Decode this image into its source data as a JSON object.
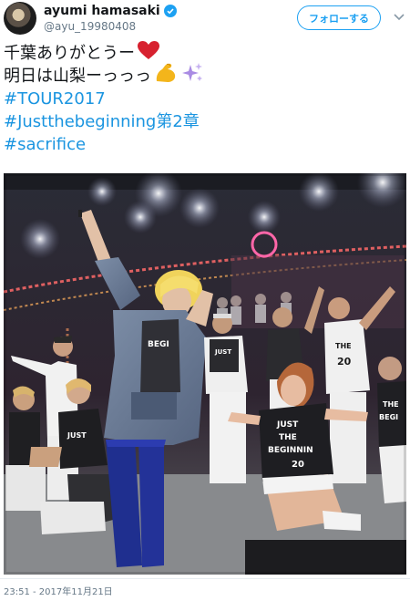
{
  "user": {
    "display_name": "ayumi hamasaki",
    "handle": "@ayu_19980408",
    "verified": true
  },
  "actions": {
    "follow_label": "フォローする"
  },
  "tweet": {
    "line1": "千葉ありがとうー",
    "line2": "明日は山梨ーっっっ",
    "hashtags": [
      "#TOUR2017",
      "#Justthebeginning第2章",
      "#sacrifice"
    ],
    "emoji": [
      "red-heart",
      "flexed-biceps",
      "sparkles"
    ]
  },
  "photo": {
    "shirt_text_main": "JUST THE BEGINNING",
    "shirt_number": "20",
    "shirt_text_short": "BEGI"
  },
  "meta": {
    "timestamp": "23:51 - 2017年11月21日"
  },
  "colors": {
    "accent": "#1da1f2",
    "hashtag": "#1b95e0",
    "muted": "#657786"
  }
}
